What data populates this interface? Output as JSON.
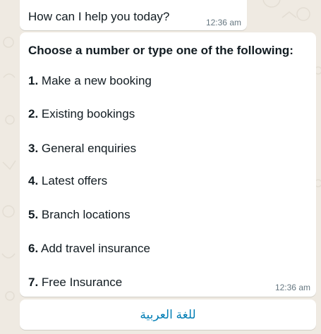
{
  "messages": {
    "greeting": {
      "text": "How can I help you today?",
      "time": "12:36 am"
    },
    "menu": {
      "heading": "Choose a number or type one of the following:",
      "items": [
        {
          "number": "1.",
          "label": "Make a new booking"
        },
        {
          "number": "2.",
          "label": "Existing bookings"
        },
        {
          "number": "3.",
          "label": "General enquiries"
        },
        {
          "number": "4.",
          "label": "Latest offers"
        },
        {
          "number": "5.",
          "label": "Branch locations"
        },
        {
          "number": "6.",
          "label": "Add travel insurance"
        },
        {
          "number": "7.",
          "label": "Free Insurance"
        }
      ],
      "time": "12:36 am"
    },
    "reply_button": {
      "label": "للغة العربية"
    }
  },
  "colors": {
    "chat_background": "#efeae2",
    "bubble": "#ffffff",
    "timestamp": "#667781",
    "button_text": "#027eb5"
  }
}
